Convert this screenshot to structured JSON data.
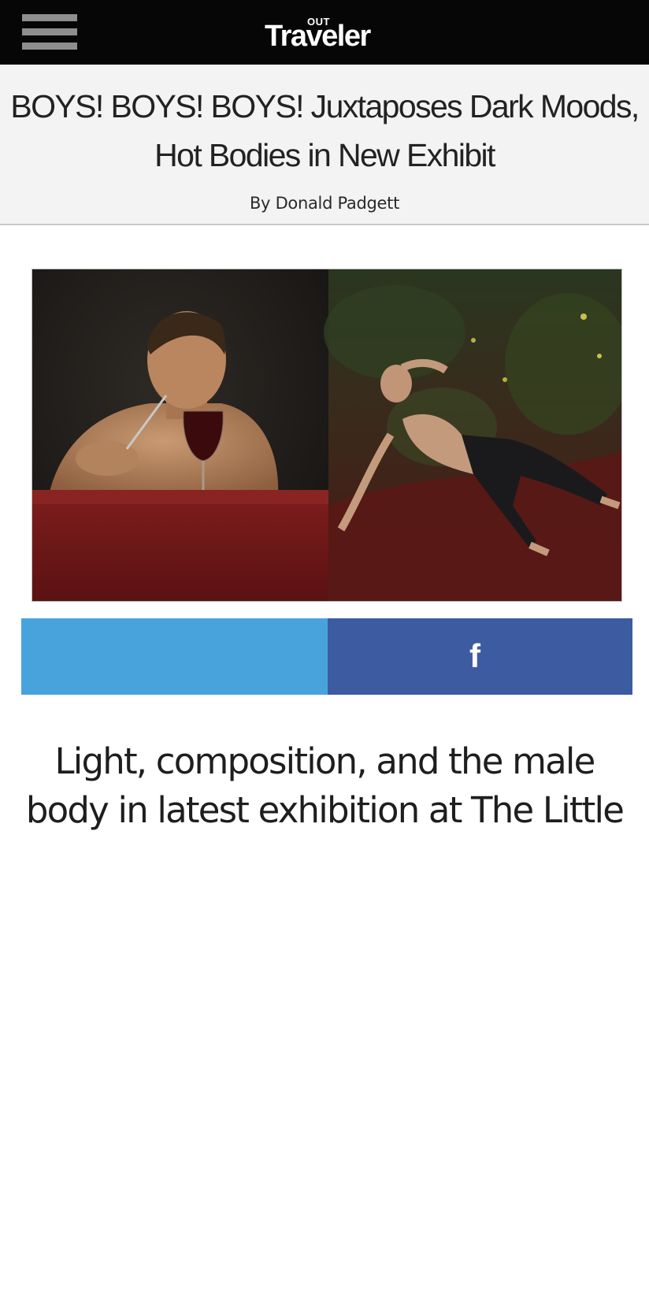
{
  "header": {
    "logo_small": "OUT",
    "logo_main": "Traveler",
    "menu_icon": "hamburger-menu-icon"
  },
  "article": {
    "headline_line1": "BOYS! BOYS! BOYS! Juxtaposes Dark Moods,",
    "headline_line2": "Hot Bodies in New Exhibit",
    "byline": "By Donald Padgett",
    "subhead_line1": "Light, composition, and the male",
    "subhead_line2": "body in latest exhibition at The Little"
  },
  "share": {
    "twitter_icon": "twitter-bird-icon",
    "facebook_icon": "facebook-f-icon",
    "facebook_glyph": "f",
    "twitter_color": "#48a3dd",
    "facebook_color": "#3d5ba1"
  },
  "colors": {
    "header_bg": "#060606",
    "title_band_bg": "#f3f3f3"
  }
}
